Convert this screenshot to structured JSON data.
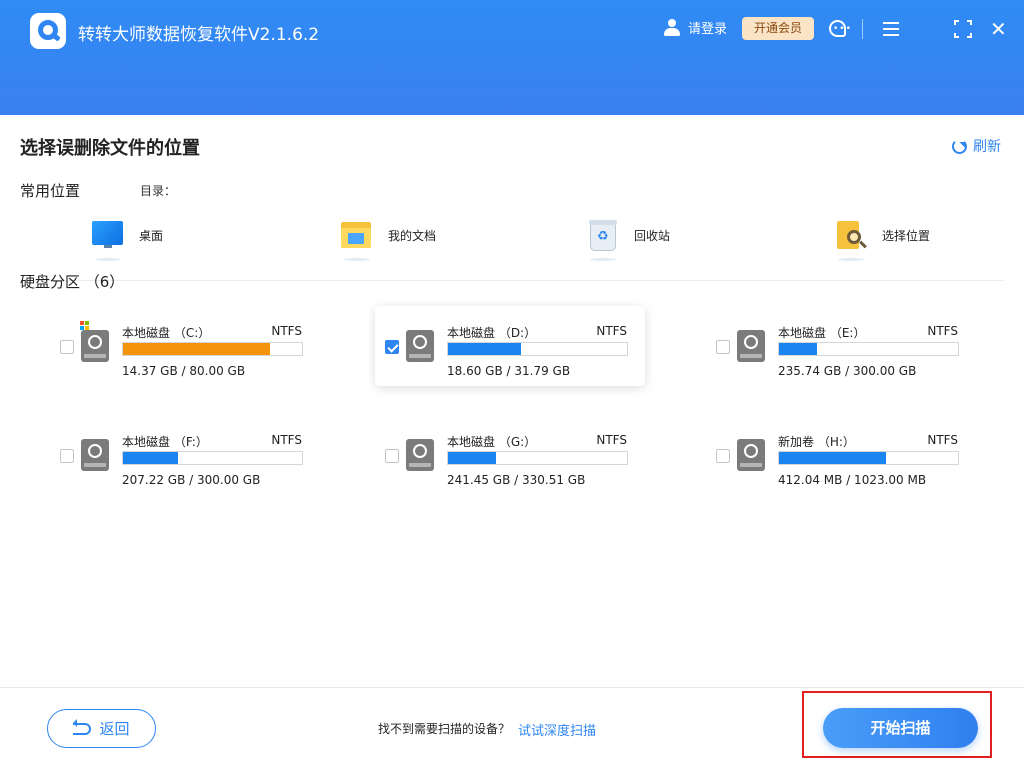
{
  "header": {
    "app_title": "转转大师数据恢复软件V2.1.6.2",
    "login_label": "请登录",
    "vip_label": "开通会员",
    "accent": "#2f86f2"
  },
  "main": {
    "page_title": "选择误删除文件的位置",
    "refresh_label": "刷新",
    "common_locations_label": "常用位置",
    "directory_label": "目录：",
    "quick_locations": [
      {
        "label": "桌面",
        "icon": "desktop-icon"
      },
      {
        "label": "我的文档",
        "icon": "documents-folder-icon"
      },
      {
        "label": "回收站",
        "icon": "recycle-bin-icon"
      },
      {
        "label": "选择位置",
        "icon": "choose-folder-icon"
      }
    ],
    "partitions_label": "硬盘分区 （6）",
    "drives": [
      {
        "name": "本地磁盘 （C:）",
        "fs": "NTFS",
        "size": "14.37 GB / 80.00 GB",
        "used_fraction": 0.82,
        "bar_color": "#f5930d",
        "checked": false,
        "system": true
      },
      {
        "name": "本地磁盘 （D:）",
        "fs": "NTFS",
        "size": "18.60 GB / 31.79 GB",
        "used_fraction": 0.41,
        "bar_color": "#1a84f0",
        "checked": true,
        "system": false
      },
      {
        "name": "本地磁盘 （E:）",
        "fs": "NTFS",
        "size": "235.74 GB / 300.00 GB",
        "used_fraction": 0.21,
        "bar_color": "#1a84f0",
        "checked": false,
        "system": false
      },
      {
        "name": "本地磁盘 （F:）",
        "fs": "NTFS",
        "size": "207.22 GB / 300.00 GB",
        "used_fraction": 0.31,
        "bar_color": "#1a84f0",
        "checked": false,
        "system": false
      },
      {
        "name": "本地磁盘 （G:）",
        "fs": "NTFS",
        "size": "241.45 GB / 330.51 GB",
        "used_fraction": 0.27,
        "bar_color": "#1a84f0",
        "checked": false,
        "system": false
      },
      {
        "name": "新加卷 （H:）",
        "fs": "NTFS",
        "size": "412.04 MB / 1023.00 MB",
        "used_fraction": 0.6,
        "bar_color": "#1a84f0",
        "checked": false,
        "system": false
      }
    ]
  },
  "footer": {
    "back_label": "返回",
    "hint": "找不到需要扫描的设备？",
    "deep_scan_link": "试试深度扫描",
    "start_label": "开始扫描",
    "highlight_color": "#e02020"
  }
}
